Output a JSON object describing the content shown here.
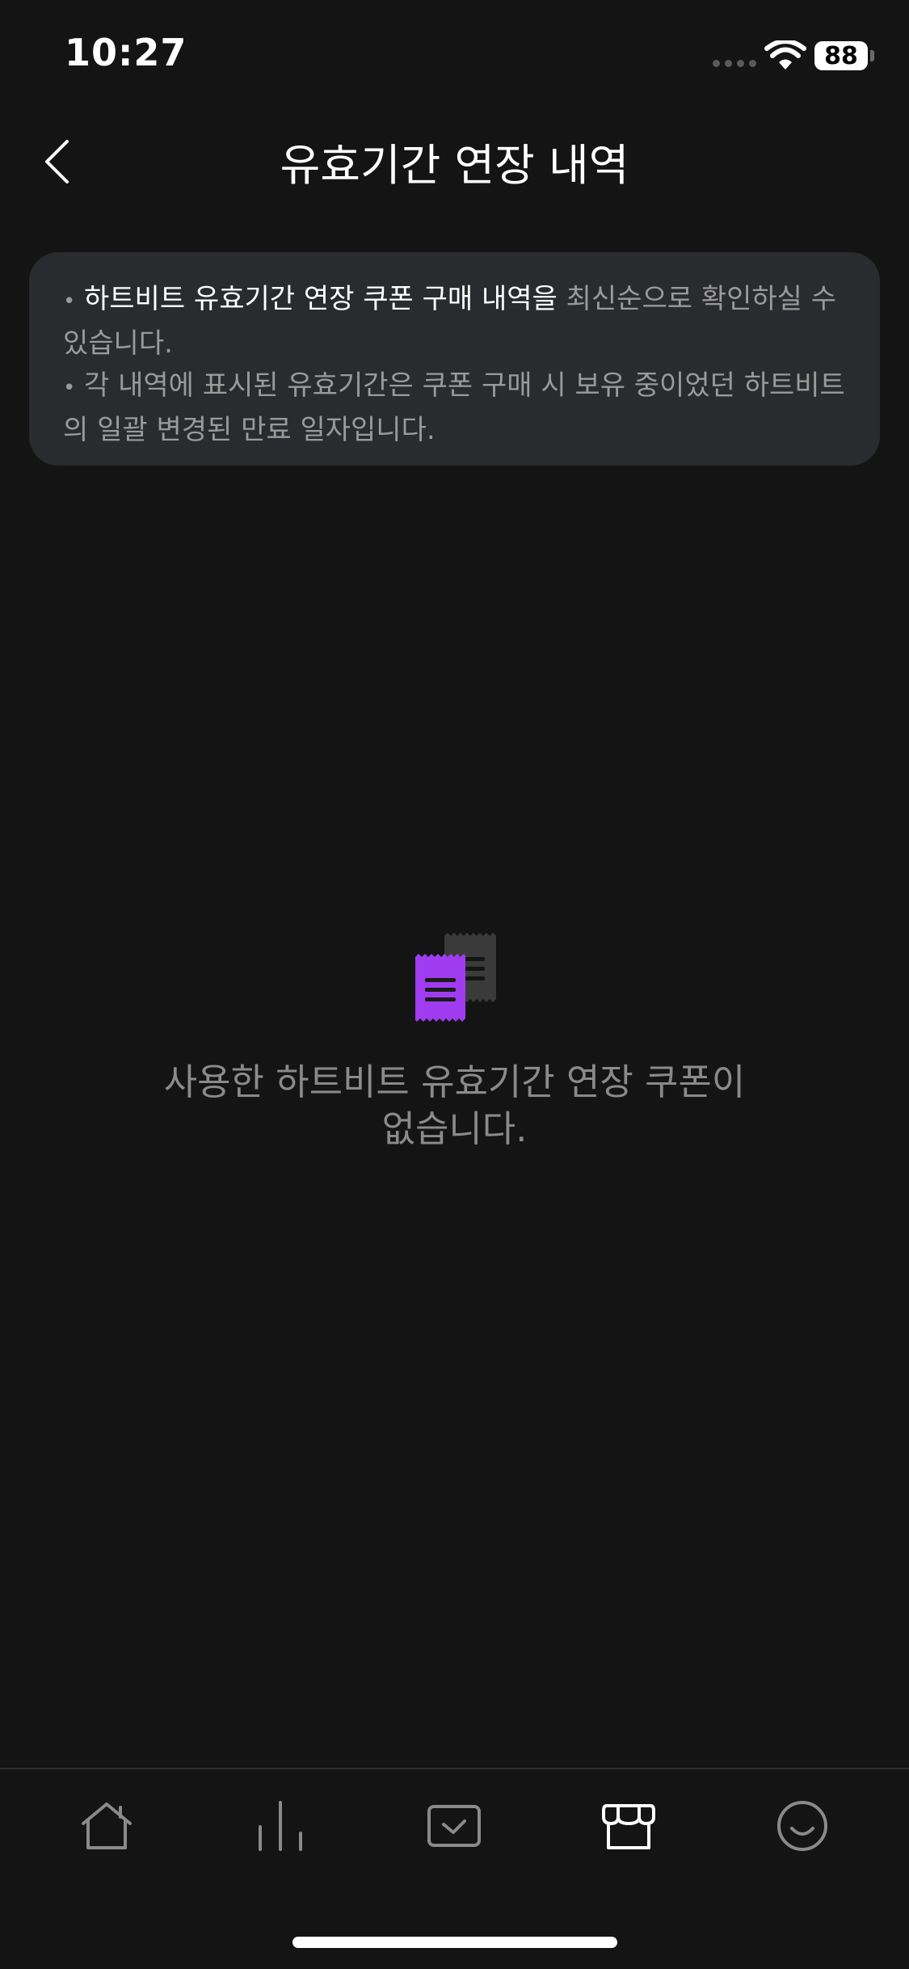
{
  "status_bar": {
    "time": "10:27",
    "battery": "88"
  },
  "header": {
    "title": "유효기간 연장 내역",
    "back_icon": "chevron-left-icon"
  },
  "info_card": {
    "line1_strong": "하트비트 유효기간 연장 쿠폰 구매 내역을",
    "line1_rest": " 최신순으로 확인하실 수 있습니다.",
    "line2": "각 내역에 표시된 유효기간은 쿠폰 구매 시 보유 중이었던 하트비트의 일괄 변경된 만료 일자입니다."
  },
  "empty_state": {
    "icon": "coupon-receipt-icon",
    "message_line1": "사용한 하트비트 유효기간 연장 쿠폰이",
    "message_line2": "없습니다.",
    "accent_color": "#a03cf0"
  },
  "tab_bar": {
    "items": [
      {
        "icon": "home-icon",
        "active": false
      },
      {
        "icon": "chart-icon",
        "active": false
      },
      {
        "icon": "vote-box-icon",
        "active": false
      },
      {
        "icon": "store-icon",
        "active": true
      },
      {
        "icon": "smile-icon",
        "active": false
      }
    ],
    "active_color": "#ffffff",
    "inactive_color": "#8a8a8a"
  }
}
